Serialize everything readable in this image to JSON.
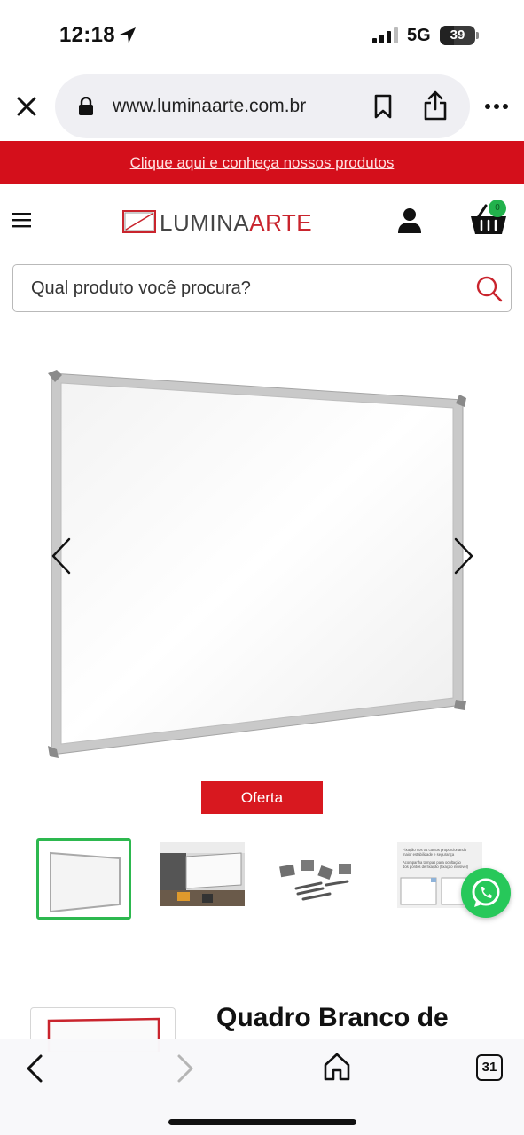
{
  "status_bar": {
    "time": "12:18",
    "network": "5G",
    "battery": "39",
    "battery_level": 0.39
  },
  "browser": {
    "url": "www.luminaarte.com.br",
    "icons": [
      "close-icon",
      "lock-icon",
      "bookmark-icon",
      "share-icon",
      "more-icon"
    ]
  },
  "promo_banner": {
    "text": "Clique aqui e conheça nossos produtos",
    "background": "#d40f1b"
  },
  "header": {
    "logo": {
      "part1": "LUMINA",
      "part2": "ARTE",
      "accent_color": "#c9242d"
    },
    "cart_badge": "0",
    "icons": [
      "menu-icon",
      "user-icon",
      "cart-icon"
    ]
  },
  "search": {
    "placeholder": "Qual produto você procura?"
  },
  "product": {
    "badge": "Oferta",
    "title": "Quadro Branco de",
    "thumbnails": [
      {
        "name": "thumb-whiteboard",
        "active": true
      },
      {
        "name": "thumb-office-room",
        "active": false
      },
      {
        "name": "thumb-mounting-kit",
        "active": false
      },
      {
        "name": "thumb-detail-sheet",
        "active": false,
        "lines": [
          "Fixação nos 04 cantos proporcionando",
          "maior estabilidade e segurança",
          "Acompanha tampas para ocultação",
          "dos pontos de fixação (fixação invisível)"
        ]
      }
    ]
  },
  "toolbar": {
    "tabs_count": "31",
    "icons": [
      "back-icon",
      "forward-icon",
      "home-icon",
      "tabs-icon"
    ]
  },
  "colors": {
    "brand_red": "#d40f1b",
    "active_green": "#2db84f",
    "whatsapp_green": "#27c85a"
  }
}
